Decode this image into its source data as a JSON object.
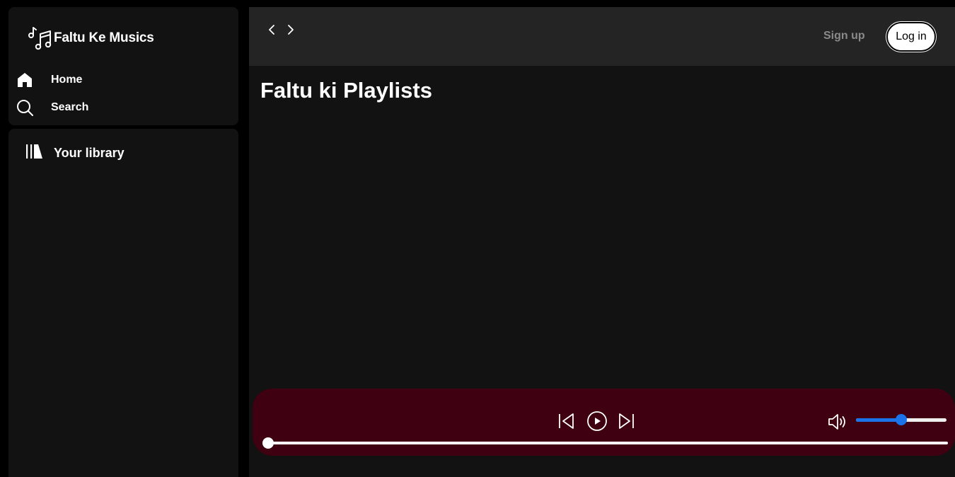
{
  "app": {
    "brand": "Faltu Ke Musics"
  },
  "sidebar": {
    "nav": [
      {
        "label": "Home",
        "icon": "home-icon"
      },
      {
        "label": "Search",
        "icon": "search-icon"
      }
    ],
    "library": {
      "label": "Your library",
      "icon": "library-icon"
    }
  },
  "topbar": {
    "back_icon": "chevron-left-icon",
    "forward_icon": "chevron-right-icon",
    "signup_label": "Sign up",
    "login_label": "Log in"
  },
  "main": {
    "title": "Faltu ki Playlists"
  },
  "player": {
    "controls": [
      "previous-icon",
      "play-icon",
      "next-icon"
    ],
    "volume_icon": "volume-icon",
    "volume_level": 0.5,
    "seek_progress": 0.0
  },
  "colors": {
    "background": "#000000",
    "panel": "#121212",
    "topbar": "#242424",
    "player_bg": "#3f0011",
    "accent": "#1a73e8"
  }
}
